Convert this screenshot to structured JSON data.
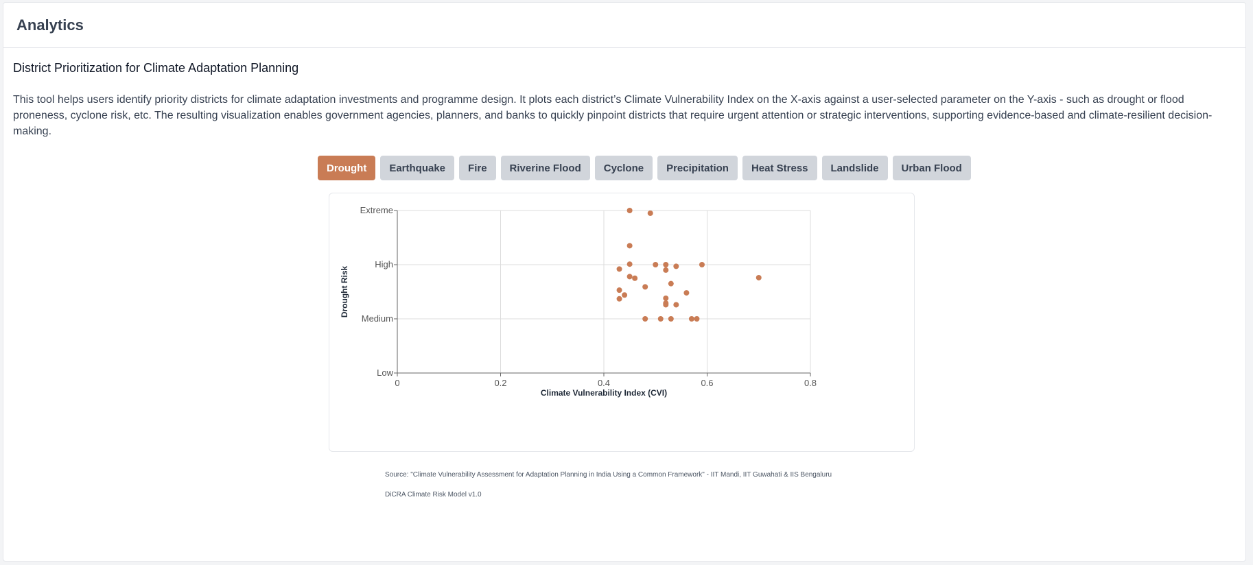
{
  "header": {
    "title": "Analytics"
  },
  "section": {
    "title": "District Prioritization for Climate Adaptation Planning",
    "description": "This tool helps users identify priority districts for climate adaptation investments and programme design. It plots each district’s Climate Vulnerability Index on the X-axis against a user-selected parameter on the Y-axis - such as drought or flood proneness, cyclone risk, etc. The resulting visualization enables government agencies, planners, and banks to quickly pinpoint districts that require urgent attention or strategic interventions, supporting evidence-based and climate-resilient decision-making."
  },
  "tabs": [
    {
      "label": "Drought",
      "active": true
    },
    {
      "label": "Earthquake",
      "active": false
    },
    {
      "label": "Fire",
      "active": false
    },
    {
      "label": "Riverine Flood",
      "active": false
    },
    {
      "label": "Cyclone",
      "active": false
    },
    {
      "label": "Precipitation",
      "active": false
    },
    {
      "label": "Heat Stress",
      "active": false
    },
    {
      "label": "Landslide",
      "active": false
    },
    {
      "label": "Urban Flood",
      "active": false
    }
  ],
  "colors": {
    "accent": "#c97c55",
    "tab_inactive": "#d1d5db",
    "point": "#c97c55"
  },
  "chart_data": {
    "type": "scatter",
    "xlabel": "Climate Vulnerability Index (CVI)",
    "ylabel": "Drought Risk",
    "xlim": [
      0,
      0.8
    ],
    "x_ticks": [
      0,
      0.2,
      0.4,
      0.6,
      0.8
    ],
    "x_tick_labels": [
      "0",
      "0.2",
      "0.4",
      "0.6",
      "0.8"
    ],
    "ylim": [
      0,
      3
    ],
    "y_ticks": [
      0,
      1,
      2,
      3
    ],
    "y_tick_labels": [
      "Low",
      "Medium",
      "High",
      "Extreme"
    ],
    "grid": true,
    "points": [
      {
        "x": 0.45,
        "y": 3.0
      },
      {
        "x": 0.49,
        "y": 2.95
      },
      {
        "x": 0.45,
        "y": 2.35
      },
      {
        "x": 0.45,
        "y": 2.01
      },
      {
        "x": 0.5,
        "y": 2.0
      },
      {
        "x": 0.52,
        "y": 2.0
      },
      {
        "x": 0.54,
        "y": 1.97
      },
      {
        "x": 0.59,
        "y": 2.0
      },
      {
        "x": 0.43,
        "y": 1.92
      },
      {
        "x": 0.52,
        "y": 1.9
      },
      {
        "x": 0.45,
        "y": 1.78
      },
      {
        "x": 0.46,
        "y": 1.75
      },
      {
        "x": 0.7,
        "y": 1.76
      },
      {
        "x": 0.53,
        "y": 1.65
      },
      {
        "x": 0.48,
        "y": 1.59
      },
      {
        "x": 0.43,
        "y": 1.53
      },
      {
        "x": 0.56,
        "y": 1.48
      },
      {
        "x": 0.44,
        "y": 1.44
      },
      {
        "x": 0.43,
        "y": 1.37
      },
      {
        "x": 0.52,
        "y": 1.38
      },
      {
        "x": 0.52,
        "y": 1.29
      },
      {
        "x": 0.52,
        "y": 1.26
      },
      {
        "x": 0.54,
        "y": 1.26
      },
      {
        "x": 0.48,
        "y": 1.0
      },
      {
        "x": 0.51,
        "y": 1.0
      },
      {
        "x": 0.53,
        "y": 1.0
      },
      {
        "x": 0.57,
        "y": 1.0
      },
      {
        "x": 0.58,
        "y": 1.0
      }
    ]
  },
  "footer": {
    "source": "Source: \"Climate Vulnerability Assessment for Adaptation Planning in India Using a Common Framework\" - IIT Mandi, IIT Guwahati & IIS Bengaluru",
    "model": "DiCRA Climate Risk Model v1.0"
  }
}
